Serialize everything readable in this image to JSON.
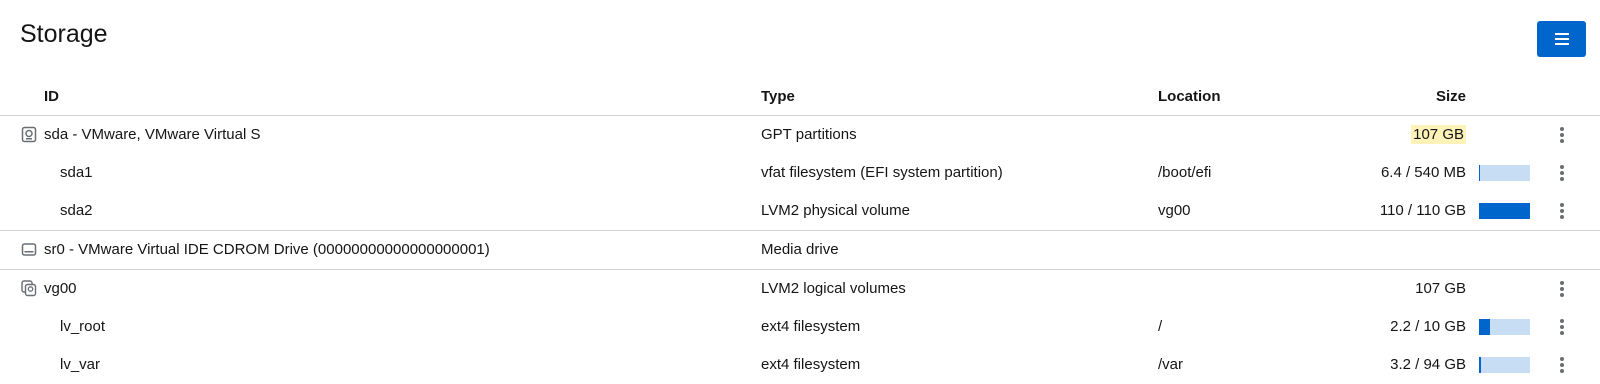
{
  "page": {
    "title": "Storage",
    "menu_icon": "hamburger-icon"
  },
  "table": {
    "headers": {
      "id": "ID",
      "type": "Type",
      "location": "Location",
      "size": "Size"
    },
    "rows": [
      {
        "id": "sda - VMware, VMware Virtual S",
        "type": "GPT partitions",
        "location": "",
        "size": "107 GB",
        "icon": "disk-icon",
        "highlight": true,
        "usage": null,
        "menu": true
      },
      {
        "id": "sda1",
        "type": "vfat filesystem (EFI system partition)",
        "location": "/boot/efi",
        "size": "6.4 / 540 MB",
        "usage": 0.012,
        "menu": true
      },
      {
        "id": "sda2",
        "type": "LVM2 physical volume",
        "location": "vg00",
        "size": "110 / 110 GB",
        "usage": 1.0,
        "menu": true
      },
      {
        "id": "sr0 - VMware Virtual IDE CDROM Drive (00000000000000000001)",
        "type": "Media drive",
        "location": "",
        "size": "",
        "icon": "cdrom-drive-icon",
        "usage": null,
        "menu": false
      },
      {
        "id": "vg00",
        "type": "LVM2 logical volumes",
        "location": "",
        "size": "107 GB",
        "icon": "volume-group-icon",
        "usage": null,
        "menu": true
      },
      {
        "id": "lv_root",
        "type": "ext4 filesystem",
        "location": "/",
        "size": "2.2 / 10 GB",
        "usage": 0.22,
        "menu": true
      },
      {
        "id": "lv_var",
        "type": "ext4 filesystem",
        "location": "/var",
        "size": "3.2 / 94 GB",
        "usage": 0.034,
        "menu": true
      }
    ]
  },
  "colors": {
    "accent": "#0066cc",
    "bar_track": "#c7ddf4",
    "highlight": "#fdf3b8"
  }
}
